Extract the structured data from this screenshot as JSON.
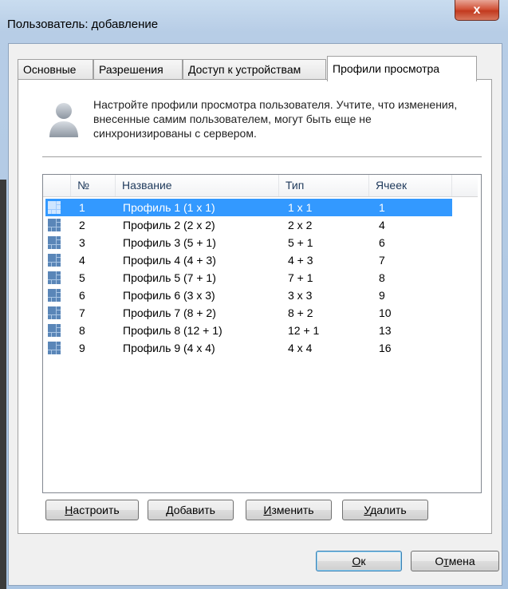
{
  "window": {
    "title": "Пользователь: добавление",
    "close_label": "x"
  },
  "tabs": [
    {
      "label": "Основные"
    },
    {
      "label": "Разрешения"
    },
    {
      "label": "Доступ к устройствам"
    },
    {
      "label": "Профили просмотра"
    }
  ],
  "info": {
    "text": "Настройте профили просмотра пользователя. Учтите, что изменения, внесенные самим пользователем, могут быть еще не синхронизированы с сервером."
  },
  "list": {
    "columns": [
      "№",
      "Название",
      "Тип",
      "Ячеек"
    ],
    "rows": [
      {
        "num": "1",
        "name": "Профиль 1 (1 x 1)",
        "type": "1 x 1",
        "cells": "1",
        "selected": true
      },
      {
        "num": "2",
        "name": "Профиль 2 (2 x 2)",
        "type": "2 x 2",
        "cells": "4",
        "selected": false
      },
      {
        "num": "3",
        "name": "Профиль 3 (5 + 1)",
        "type": "5 + 1",
        "cells": "6",
        "selected": false
      },
      {
        "num": "4",
        "name": "Профиль 4 (4 + 3)",
        "type": "4 + 3",
        "cells": "7",
        "selected": false
      },
      {
        "num": "5",
        "name": "Профиль 5 (7 + 1)",
        "type": "7 + 1",
        "cells": "8",
        "selected": false
      },
      {
        "num": "6",
        "name": "Профиль 6 (3 x 3)",
        "type": "3 x 3",
        "cells": "9",
        "selected": false
      },
      {
        "num": "7",
        "name": "Профиль 7 (8 + 2)",
        "type": "8 + 2",
        "cells": "10",
        "selected": false
      },
      {
        "num": "8",
        "name": "Профиль 8 (12 + 1)",
        "type": "12 + 1",
        "cells": "13",
        "selected": false
      },
      {
        "num": "9",
        "name": "Профиль 9 (4 x 4)",
        "type": "4 x 4",
        "cells": "16",
        "selected": false
      }
    ]
  },
  "actions": {
    "configure": {
      "accel": "Н",
      "rest": "астроить"
    },
    "add": {
      "accel": "Д",
      "rest": "обавить"
    },
    "edit": {
      "accel": "И",
      "rest": "зменить"
    },
    "delete": {
      "accel": "У",
      "rest": "далить"
    }
  },
  "dialog_buttons": {
    "ok": {
      "accel": "О",
      "rest": "к"
    },
    "cancel": {
      "pre": "О",
      "accel": "т",
      "rest": "мена"
    }
  },
  "colors": {
    "selection": "#3399ff",
    "header_text": "#1e395b",
    "close_button": "#c23a1f"
  },
  "icons": {
    "user": "user-icon",
    "row": "grid-layout-icon"
  }
}
